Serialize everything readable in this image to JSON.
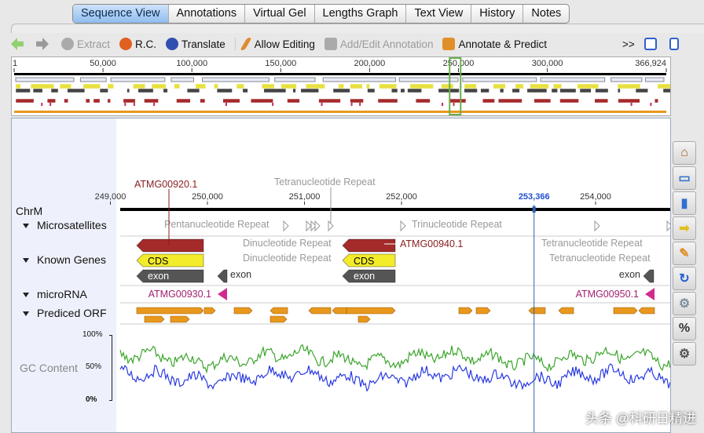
{
  "tabs": [
    "Sequence View",
    "Annotations",
    "Virtual Gel",
    "Lengths Graph",
    "Text View",
    "History",
    "Notes"
  ],
  "active_tab": 0,
  "toolbar": {
    "back": "back-arrow",
    "forward": "forward-arrow",
    "extract": "Extract",
    "rc": "R.C.",
    "translate": "Translate",
    "allow_editing": "Allow Editing",
    "add_edit": "Add/Edit Annotation",
    "annotate_predict": "Annotate & Predict",
    "more": ">>"
  },
  "overview": {
    "ticks": [
      "1",
      "50,000",
      "100,000",
      "150,000",
      "200,000",
      "250,000",
      "300,000",
      "366,924"
    ],
    "sequence_length": 366924
  },
  "sequence_name": "ChrM",
  "tracks": [
    "Microsatellites",
    "Known Genes",
    "microRNA",
    "Prediced ORF"
  ],
  "gc_track": {
    "label": "GC Content",
    "ticks": [
      "100%",
      "50%",
      "0%"
    ]
  },
  "ruler": {
    "ticks": [
      "249,000",
      "250,000",
      "251,000",
      "252,000",
      "254,000"
    ],
    "cursor": "253,366"
  },
  "genes": [
    {
      "name": "ATMG00920.1",
      "cds": "CDS",
      "exon": "exon"
    },
    {
      "name": "ATMG00940.1",
      "cds": "CDS",
      "exon": "exon"
    }
  ],
  "small_exons": [
    "exon",
    "exon"
  ],
  "microrna": [
    "ATMG00930.1",
    "ATMG00950.1"
  ],
  "microsatellites": [
    "Tetranucleotide Repeat",
    "Pentanucleotide Repeat",
    "Trinucleotide Repeat",
    "Dinucleotide Repeat",
    "Dinucleotide Repeat",
    "Tetranucleotide Repeat",
    "Tetranucleotide Repeat"
  ],
  "colors": {
    "gene": "#a52a2a",
    "cds": "#f2ec2a",
    "exon": "#555555",
    "microrna": "#d02a90",
    "orf": "#e8981c",
    "gc_green": "#3aa52a",
    "gc_blue": "#2a3ae0",
    "cursor": "#3060b0",
    "viewport": "#6ab04a"
  },
  "side_icons": [
    "home-icon",
    "monitor-icon",
    "bar-chart-icon",
    "arrow-right-icon",
    "annotate-icon",
    "refresh-icon",
    "gear-icon",
    "percent-icon",
    "settings-icon"
  ],
  "watermark": "头条 @科研日精进"
}
